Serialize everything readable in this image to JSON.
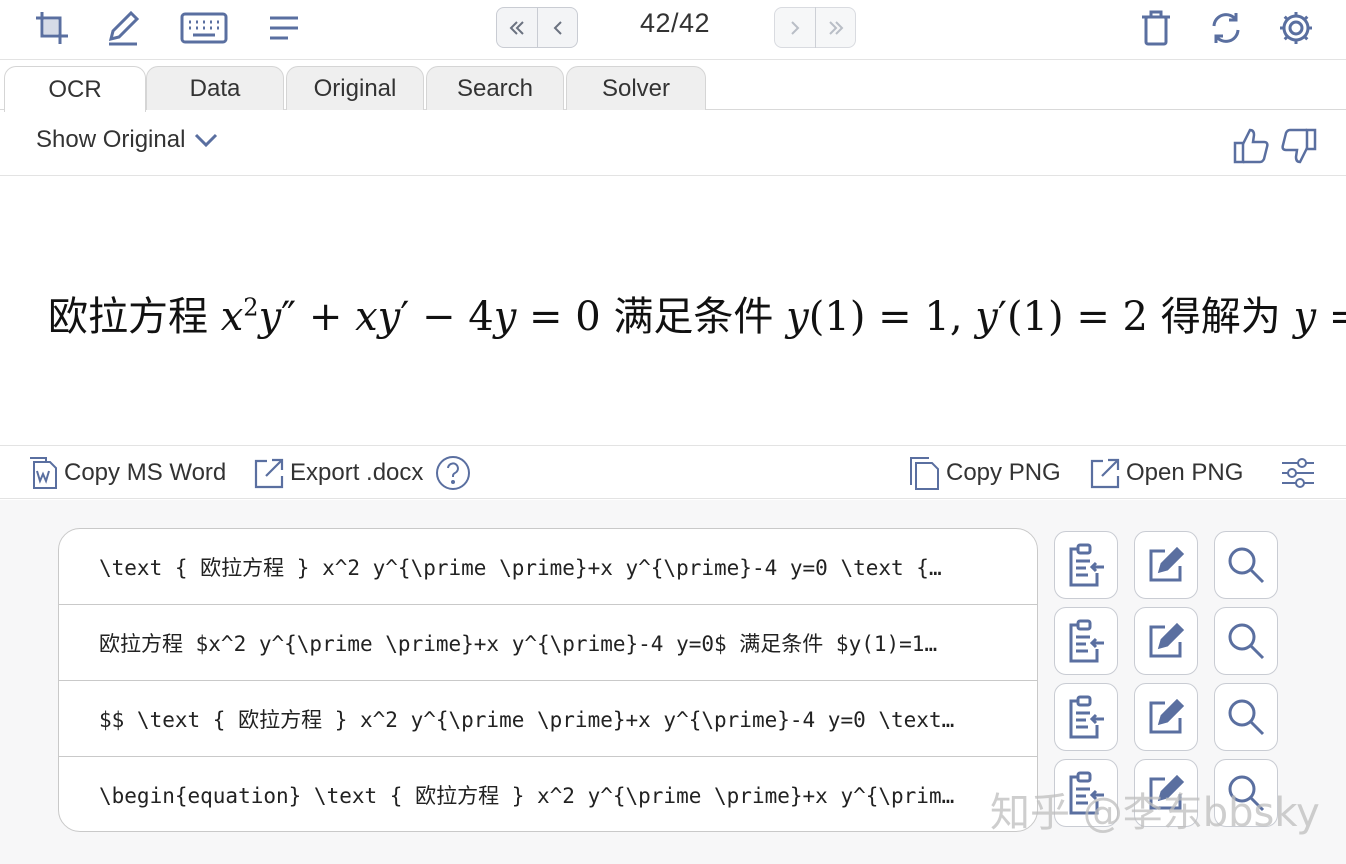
{
  "toolbar": {
    "icons": [
      "snip-icon",
      "pen-icon",
      "keyboard-icon",
      "menu-icon",
      "trash-icon",
      "refresh-icon",
      "gear-icon"
    ],
    "page_counter": "42/42",
    "accent_color": "#5a6fa0"
  },
  "tabs": [
    {
      "label": "OCR",
      "active": true
    },
    {
      "label": "Data",
      "active": false
    },
    {
      "label": "Original",
      "active": false
    },
    {
      "label": "Search",
      "active": false
    },
    {
      "label": "Solver",
      "active": false
    }
  ],
  "show_original": {
    "label": "Show Original"
  },
  "rendered": {
    "prefix": "欧拉方程",
    "mid": "满足条件",
    "suffix": "得解为"
  },
  "actions": {
    "copy_ms_word": "Copy MS Word",
    "export_docx": "Export .docx",
    "copy_png": "Copy PNG",
    "open_png": "Open PNG"
  },
  "formats": [
    "\\text { 欧拉方程 } x^2 y^{\\prime \\prime}+x y^{\\prime}-4 y=0 \\text {…",
    "欧拉方程 $x^2 y^{\\prime \\prime}+x y^{\\prime}-4 y=0$ 满足条件 $y(1)=1…",
    "$$ \\text { 欧拉方程 } x^2 y^{\\prime \\prime}+x y^{\\prime}-4 y=0 \\text…",
    "\\begin{equation} \\text { 欧拉方程 } x^2 y^{\\prime \\prime}+x y^{\\prim…"
  ],
  "watermark": "知乎 @李东bbsky"
}
